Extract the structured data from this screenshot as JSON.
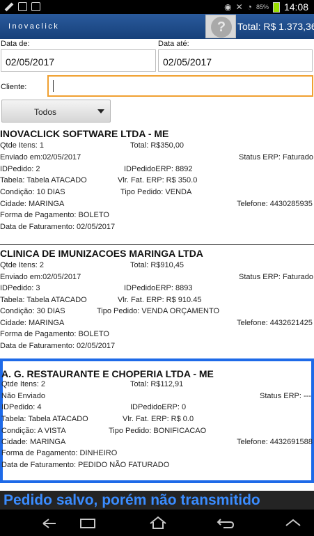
{
  "statusbar": {
    "battery": "85%",
    "time": "14:08"
  },
  "header": {
    "app_name": "Inovaclick",
    "total": "Total: R$ 1.373,36"
  },
  "filters": {
    "date_from_label": "Data de:",
    "date_from_value": "02/05/2017",
    "date_to_label": "Data até:",
    "date_to_value": "02/05/2017",
    "client_label": "Cliente:",
    "client_value": "",
    "status_filter": "Todos"
  },
  "orders": [
    {
      "client": "INOVACLICK SOFTWARE LTDA - ME",
      "items": "Qtde Itens: 1",
      "total": "Total: R$350,00",
      "sent": "Enviado em:02/05/2017",
      "erp_status": "Status ERP: Faturado",
      "id": "IDPedido: 2",
      "erp_id": "IDPedidoERP: 8892",
      "table": "Tabela: Tabela ATACADO",
      "erp_value": "Vlr. Fat. ERP: R$ 350.0",
      "condition": "Condição: 10 DIAS",
      "order_type": "Tipo Pedido: VENDA",
      "city": "Cidade: MARINGA",
      "phone": "Telefone: 4430285935",
      "payment": "Forma de Pagamento: BOLETO",
      "billing_date": "Data de Faturamento: 02/05/2017"
    },
    {
      "client": "CLINICA DE IMUNIZACOES MARINGA LTDA",
      "items": "Qtde Itens: 2",
      "total": "Total: R$910,45",
      "sent": "Enviado em:02/05/2017",
      "erp_status": "Status ERP: Faturado",
      "id": "IDPedido: 3",
      "erp_id": "IDPedidoERP: 8893",
      "table": "Tabela: Tabela ATACADO",
      "erp_value": "Vlr. Fat. ERP: R$ 910.45",
      "condition": "Condição: 30 DIAS",
      "order_type": "Tipo Pedido: VENDA ORÇAMENTO",
      "city": "Cidade: MARINGA",
      "phone": "Telefone: 4432621425",
      "payment": "Forma de Pagamento: BOLETO",
      "billing_date": "Data de Faturamento: 02/05/2017"
    },
    {
      "client": "A. G. RESTAURANTE E CHOPERIA LTDA - ME",
      "items": "Qtde Itens: 2",
      "total": "Total: R$112,91",
      "sent": "Não Enviado",
      "erp_status": "Status ERP: ---",
      "id": "IDPedido: 4",
      "erp_id": "IDPedidoERP: 0",
      "table": "Tabela: Tabela ATACADO",
      "erp_value": "Vlr. Fat. ERP: R$ 0.0",
      "condition": "Condição: A VISTA",
      "order_type": "Tipo Pedido: BONIFICACAO",
      "city": "Cidade: MARINGA",
      "phone": "Telefone: 4432691588",
      "payment": "Forma de Pagamento: DINHEIRO",
      "billing_date": "Data de Faturamento: PEDIDO NÃO FATURADO"
    }
  ],
  "toast": "Pedido salvo, porém não transmitido",
  "colors": {
    "header_blue": "#1f4f8f",
    "accent_orange": "#f0a030",
    "selection_blue": "#1e6ae8",
    "toast_text": "#3a8cff"
  },
  "icons": [
    "wrench-icon",
    "image-icon",
    "briefcase-icon",
    "eye-icon",
    "mute-icon",
    "wifi-icon",
    "battery-icon",
    "help-icon",
    "back-icon",
    "home-icon",
    "recents-icon",
    "menu-up-icon"
  ]
}
